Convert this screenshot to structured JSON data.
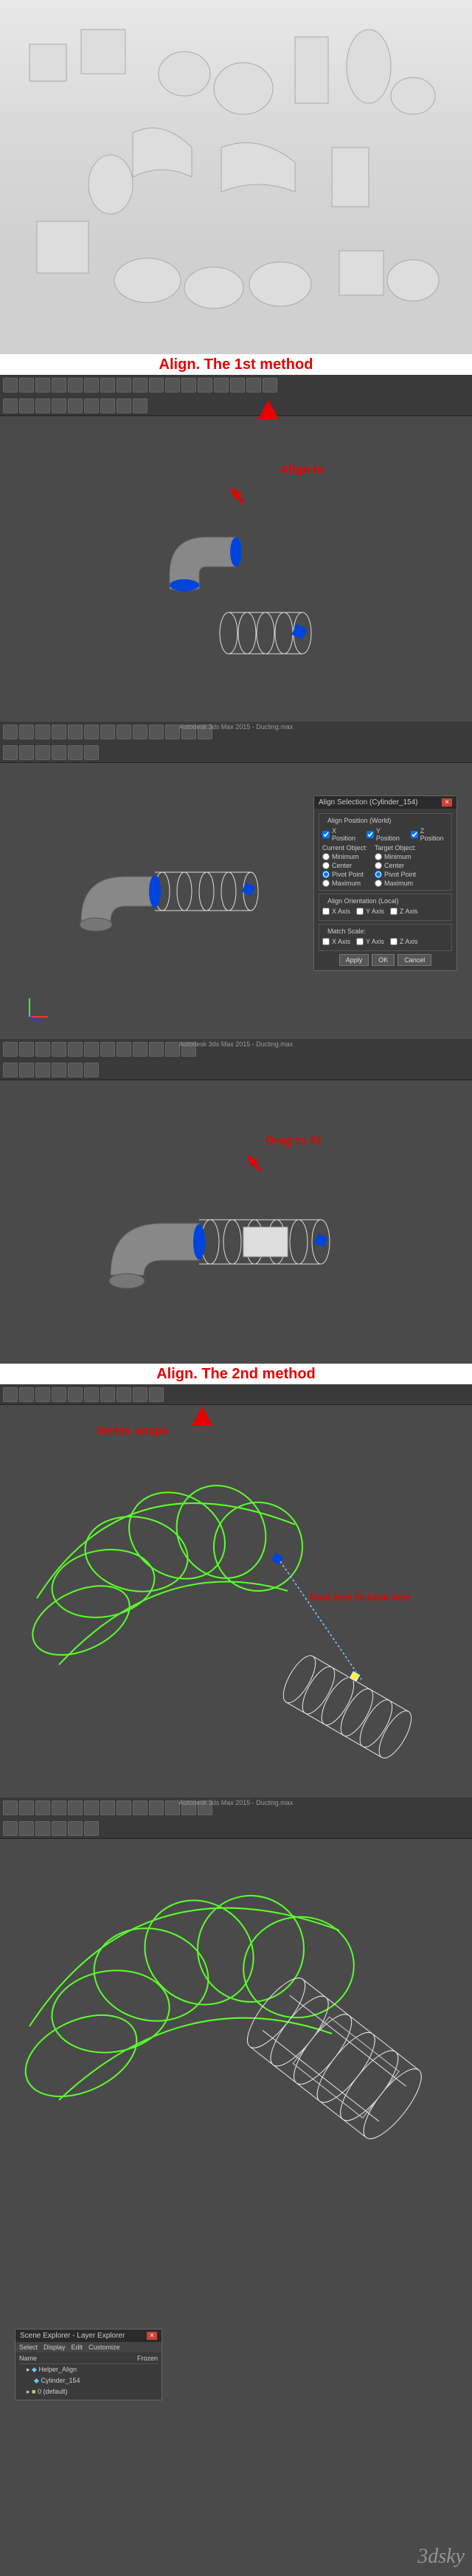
{
  "render": {
    "alt": "3D render of ventilation duct parts"
  },
  "panels": {
    "method1": {
      "title": "Align. The 1st method",
      "align_to": "Align to",
      "drag_to_fit": "Drag to fit",
      "app_title": "Autodesk 3ds Max 2015 - Ducting.max"
    },
    "method2": {
      "title": "Align. The 2nd method",
      "vertex_snaps": "Vertex snaps",
      "blue_to_blue": "blue box to blue box"
    }
  },
  "align_dialog": {
    "title": "Align Selection (Cylinder_154)",
    "group_pos": "Align Position (World)",
    "x": "X Position",
    "y": "Y Position",
    "z": "Z Position",
    "current": "Current Object:",
    "target": "Target Object:",
    "min": "Minimum",
    "center": "Center",
    "pivot": "Pivot Point",
    "max": "Maximum",
    "group_orient": "Align Orientation (Local)",
    "xa": "X Axis",
    "ya": "Y Axis",
    "za": "Z Axis",
    "group_scale": "Match Scale:",
    "apply": "Apply",
    "ok": "OK",
    "cancel": "Cancel"
  },
  "scene_explorer": {
    "title": "Scene Explorer - Layer Explorer",
    "menu": [
      "Select",
      "Display",
      "Edit",
      "Customize"
    ],
    "cols": [
      "Name",
      "Frozen"
    ],
    "items": [
      "Helper_Align",
      "Cylinder_154",
      "0 (default)"
    ]
  },
  "watermark": "3dsky"
}
